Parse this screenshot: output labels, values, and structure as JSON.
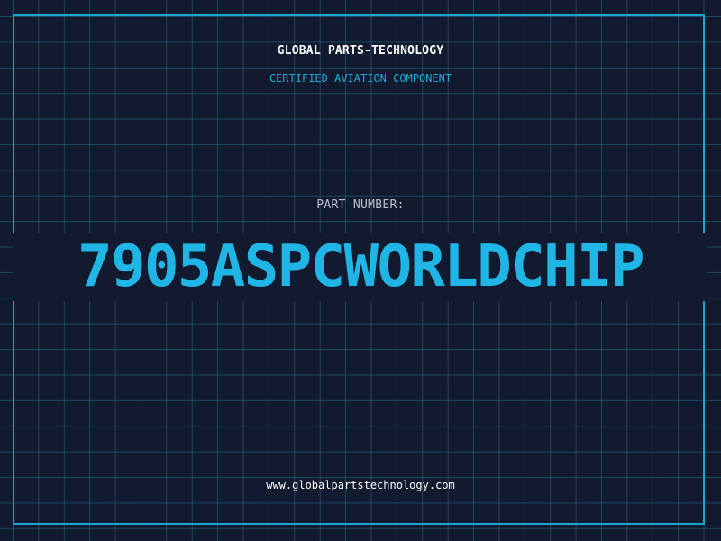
{
  "header": {
    "company": "GLOBAL PARTS-TECHNOLOGY",
    "tagline": "CERTIFIED AVIATION COMPONENT"
  },
  "part": {
    "label": "PART NUMBER:",
    "number": "7905ASPCWORLDCHIP"
  },
  "footer": {
    "url": "www.globalpartstechnology.com"
  },
  "colors": {
    "background": "#111a2e",
    "accent": "#1fb6e6",
    "grid": "#236e8c"
  }
}
